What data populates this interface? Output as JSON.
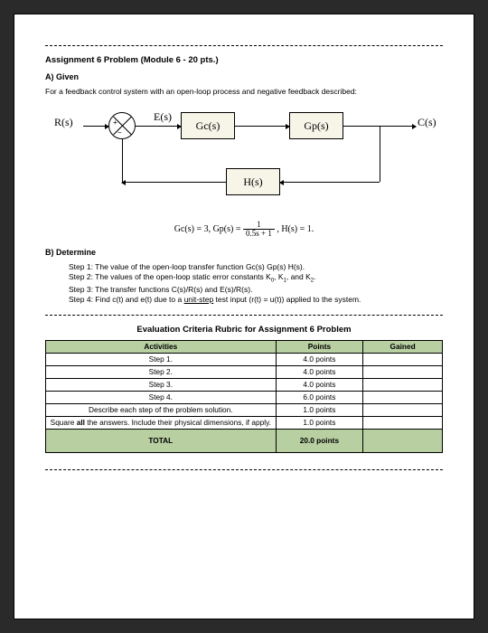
{
  "title": "Assignment 6 Problem (Module 6 - 20 pts.)",
  "sectA": "A) Given",
  "givenDesc": "For a feedback control system with an open-loop process and negative feedback described:",
  "signals": {
    "r": "R(s)",
    "e": "E(s)",
    "c": "C(s)"
  },
  "blocks": {
    "gc": "Gc(s)",
    "gp": "Gp(s)",
    "h": "H(s)"
  },
  "sum": {
    "plus": "+",
    "minus": "−"
  },
  "eq": {
    "pre": "Gc(s) = 3,  Gp(s) = ",
    "num": "1",
    "den": "0.5s + 1",
    "post": ",  H(s) = 1."
  },
  "sectB": "B) Determine",
  "steps": [
    "Step 1: The value of the open-loop transfer function Gc(s) Gp(s) H(s).",
    "Step 2: The values of the open-loop static error constants K0, K1, and K2.",
    "Step 3: The transfer functions C(s)/R(s) and E(s)/R(s).",
    "Step 4: Find c(t) and e(t) due to a unit-step test input (r(t) = u(t)) applied to the system."
  ],
  "rubricTitle": "Evaluation Criteria Rubric for Assignment 6 Problem",
  "rubricHeaders": {
    "activities": "Activities",
    "points": "Points",
    "gained": "Gained"
  },
  "rubricRows": [
    {
      "act": "Step 1.",
      "pts": "4.0 points"
    },
    {
      "act": "Step 2.",
      "pts": "4.0 points"
    },
    {
      "act": "Step 3.",
      "pts": "4.0 points"
    },
    {
      "act": "Step 4.",
      "pts": "6.0 points"
    },
    {
      "act": "Describe each step of the problem solution.",
      "pts": "1.0 points"
    },
    {
      "act": "Square all the answers. Include their physical dimensions, if apply.",
      "pts": "1.0 points"
    }
  ],
  "rubricTotal": {
    "label": "TOTAL",
    "pts": "20.0 points"
  }
}
